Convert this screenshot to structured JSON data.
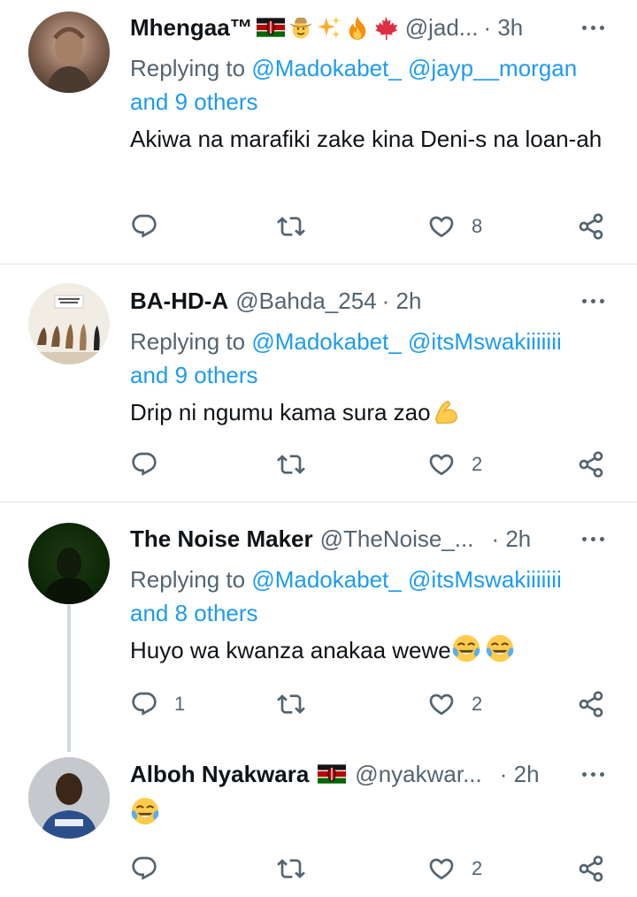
{
  "tweets": [
    {
      "name": "Mhengaa™",
      "handle": "@jad...",
      "time": "· 3h",
      "reply_prefix": "Replying to",
      "reply_targets": "@Madokabet_ @jayp__morgan",
      "reply_others": "and 9 others",
      "text": "Akiwa na marafiki zake kina Deni-s na loan-ah",
      "reply_count": "",
      "retweet_count": "",
      "like_count": "8"
    },
    {
      "name": "BA-HD-A",
      "handle": "@Bahda_254",
      "time": "· 2h",
      "reply_prefix": "Replying to",
      "reply_targets": "@Madokabet_ @itsMswakiiiiiii",
      "reply_others": "and 9 others",
      "text": "Drip ni ngumu kama sura zao",
      "reply_count": "",
      "retweet_count": "",
      "like_count": "2"
    },
    {
      "name": "The Noise Maker",
      "handle": "@TheNoise_...",
      "time": "· 2h",
      "reply_prefix": "Replying to",
      "reply_targets": "@Madokabet_ @itsMswakiiiiiii",
      "reply_others": "and 8 others",
      "text": "Huyo wa kwanza anakaa wewe",
      "reply_count": "1",
      "retweet_count": "",
      "like_count": "2"
    },
    {
      "name": "Alboh Nyakwara",
      "handle": "@nyakwar...",
      "time": "· 2h",
      "text": "",
      "reply_count": "",
      "retweet_count": "",
      "like_count": "2"
    }
  ],
  "colors": {
    "link": "#1d9bf0",
    "secondary_text": "#536471",
    "primary_text": "#0f1419",
    "divider": "#e1e8ed",
    "thread_line": "#cfd9de"
  },
  "icons": [
    "reply-icon",
    "retweet-icon",
    "like-icon",
    "share-icon",
    "more-icon",
    "kenya-flag-emoji",
    "cowboy-emoji",
    "sparkles-emoji",
    "fire-emoji",
    "maple-leaf-emoji",
    "flexed-biceps-emoji",
    "tears-of-joy-emoji"
  ]
}
